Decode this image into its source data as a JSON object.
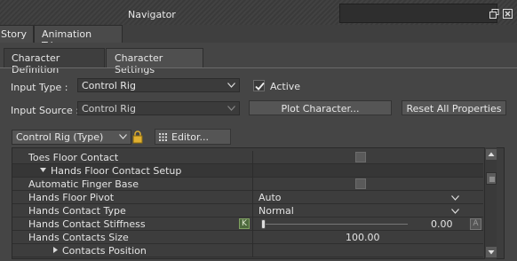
{
  "window": {
    "title": "Navigator"
  },
  "top_tabs": [
    "Story",
    "Animation Trigger"
  ],
  "sub_tabs": {
    "items": [
      "Character Definition",
      "Character Settings"
    ],
    "active_index": 1
  },
  "controls": {
    "input_type_label": "Input Type :",
    "input_type_value": "Control Rig",
    "active_label": "Active",
    "active_checked": true,
    "input_source_label": "Input Source :",
    "input_source_value": "Control Rig",
    "plot_button": "Plot Character...",
    "reset_button": "Reset All Properties"
  },
  "toolbar": {
    "type_combo": "Control Rig (Type)",
    "editor_button": "Editor..."
  },
  "properties": [
    {
      "name": "Toes Floor Contact",
      "indent": 1,
      "check": true
    },
    {
      "name": "Hands Floor Contact Setup",
      "indent": 2,
      "expanded": true,
      "header": true
    },
    {
      "name": "Automatic Finger Base",
      "indent": 1,
      "check": true
    },
    {
      "name": "Hands Floor Pivot",
      "indent": 1,
      "value": "Auto",
      "dropdown": true
    },
    {
      "name": "Hands Contact Type",
      "indent": 1,
      "value": "Normal",
      "dropdown": true
    },
    {
      "name": "Hands Contact Stiffness",
      "indent": 1,
      "key_label": "K",
      "slider": 0.0,
      "value": "0.00"
    },
    {
      "name": "Hands Contacts Size",
      "indent": 1,
      "value": "100.00"
    },
    {
      "name": "Contacts Position",
      "indent": 3,
      "collapsed": true
    }
  ],
  "icons": {
    "dropdown": "chevron-down-icon",
    "lock": "lock-icon",
    "editor": "editor-icon",
    "restore": "restore-window-icon",
    "close": "close-icon"
  }
}
